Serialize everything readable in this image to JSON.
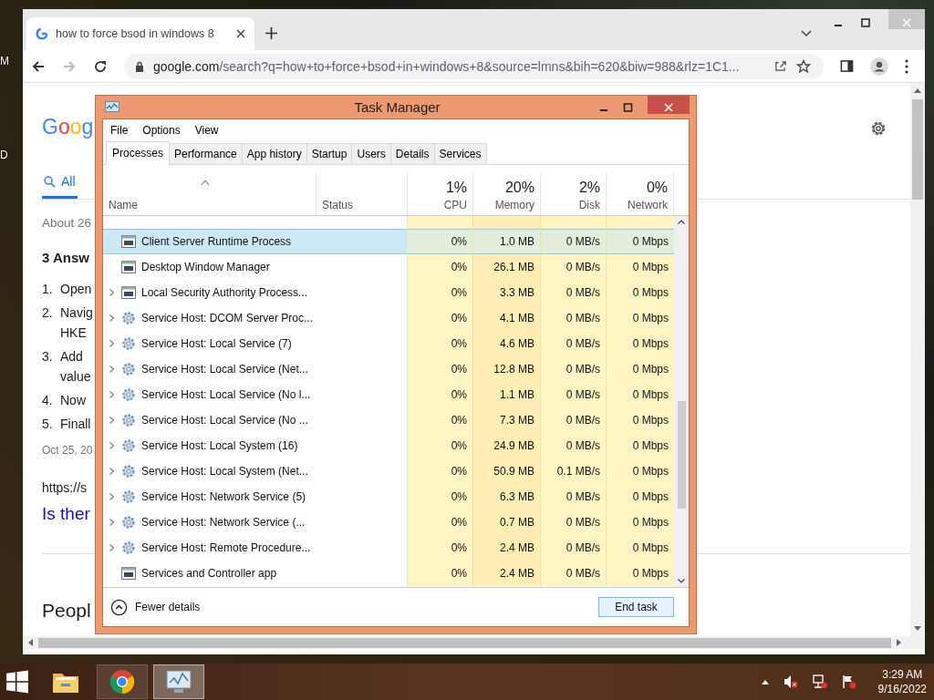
{
  "desktop_labels": [
    "M",
    "D"
  ],
  "browser": {
    "tab": {
      "title": "how to force bsod in windows 8"
    },
    "address": {
      "host": "google.com",
      "path": "/search?q=how+to+force+bsod+in+windows+8&source=lmns&bih=620&biw=988&rlz=1C1..."
    }
  },
  "google": {
    "logo": "Goog",
    "nav_tab": {
      "label": "All",
      "selected": true
    },
    "result_count": "About 26",
    "answer_heading": "3 Answ",
    "steps": [
      {
        "number": "1.",
        "lines": [
          "Open"
        ]
      },
      {
        "number": "2.",
        "lines": [
          "Navig",
          "HKE"
        ]
      },
      {
        "number": "3.",
        "lines": [
          "Add",
          "value"
        ]
      },
      {
        "number": "4.",
        "lines": [
          "Now"
        ]
      },
      {
        "number": "5.",
        "lines": [
          "Finall"
        ]
      }
    ],
    "date": "Oct 25, 20",
    "url": "https://s",
    "link": "Is ther",
    "section_heading": "Peopl"
  },
  "task_manager": {
    "title": "Task Manager",
    "menu": [
      "File",
      "Options",
      "View"
    ],
    "tabs": [
      {
        "label": "Processes",
        "selected": true
      },
      {
        "label": "Performance",
        "selected": false
      },
      {
        "label": "App history",
        "selected": false
      },
      {
        "label": "Startup",
        "selected": false
      },
      {
        "label": "Users",
        "selected": false
      },
      {
        "label": "Details",
        "selected": false
      },
      {
        "label": "Services",
        "selected": false
      }
    ],
    "columns": [
      {
        "label": "Name"
      },
      {
        "label": "Status"
      },
      {
        "summary": "1%",
        "label": "CPU"
      },
      {
        "summary": "20%",
        "label": "Memory"
      },
      {
        "summary": "2%",
        "label": "Disk"
      },
      {
        "summary": "0%",
        "label": "Network"
      }
    ],
    "rows": [
      {
        "name": "Client Server Runtime Process",
        "kind": "window",
        "expandable": false,
        "selected": true,
        "cpu": "0%",
        "memory": "1.0 MB",
        "disk": "0 MB/s",
        "network": "0 Mbps"
      },
      {
        "name": "Desktop Window Manager",
        "kind": "window",
        "expandable": false,
        "selected": false,
        "cpu": "0%",
        "memory": "26.1 MB",
        "disk": "0 MB/s",
        "network": "0 Mbps"
      },
      {
        "name": "Local Security Authority Process...",
        "kind": "window",
        "expandable": true,
        "selected": false,
        "cpu": "0%",
        "memory": "3.3 MB",
        "disk": "0 MB/s",
        "network": "0 Mbps"
      },
      {
        "name": "Service Host: DCOM Server Proc...",
        "kind": "gear",
        "expandable": true,
        "selected": false,
        "cpu": "0%",
        "memory": "4.1 MB",
        "disk": "0 MB/s",
        "network": "0 Mbps"
      },
      {
        "name": "Service Host: Local Service (7)",
        "kind": "gear",
        "expandable": true,
        "selected": false,
        "cpu": "0%",
        "memory": "4.6 MB",
        "disk": "0 MB/s",
        "network": "0 Mbps"
      },
      {
        "name": "Service Host: Local Service (Net...",
        "kind": "gear",
        "expandable": true,
        "selected": false,
        "cpu": "0%",
        "memory": "12.8 MB",
        "disk": "0 MB/s",
        "network": "0 Mbps"
      },
      {
        "name": "Service Host: Local Service (No l...",
        "kind": "gear",
        "expandable": true,
        "selected": false,
        "cpu": "0%",
        "memory": "1.1 MB",
        "disk": "0 MB/s",
        "network": "0 Mbps"
      },
      {
        "name": "Service Host: Local Service (No ...",
        "kind": "gear",
        "expandable": true,
        "selected": false,
        "cpu": "0%",
        "memory": "7.3 MB",
        "disk": "0 MB/s",
        "network": "0 Mbps"
      },
      {
        "name": "Service Host: Local System (16)",
        "kind": "gear",
        "expandable": true,
        "selected": false,
        "cpu": "0%",
        "memory": "24.9 MB",
        "disk": "0 MB/s",
        "network": "0 Mbps"
      },
      {
        "name": "Service Host: Local System (Net...",
        "kind": "gear",
        "expandable": true,
        "selected": false,
        "cpu": "0%",
        "memory": "50.9 MB",
        "disk": "0.1 MB/s",
        "network": "0 Mbps"
      },
      {
        "name": "Service Host: Network Service (5)",
        "kind": "gear",
        "expandable": true,
        "selected": false,
        "cpu": "0%",
        "memory": "6.3 MB",
        "disk": "0 MB/s",
        "network": "0 Mbps"
      },
      {
        "name": "Service Host: Network Service (...",
        "kind": "gear",
        "expandable": true,
        "selected": false,
        "cpu": "0%",
        "memory": "0.7 MB",
        "disk": "0 MB/s",
        "network": "0 Mbps"
      },
      {
        "name": "Service Host: Remote Procedure...",
        "kind": "gear",
        "expandable": true,
        "selected": false,
        "cpu": "0%",
        "memory": "2.4 MB",
        "disk": "0 MB/s",
        "network": "0 Mbps"
      },
      {
        "name": "Services and Controller app",
        "kind": "window",
        "expandable": false,
        "selected": false,
        "cpu": "0%",
        "memory": "2.4 MB",
        "disk": "0 MB/s",
        "network": "0 Mbps"
      }
    ],
    "fewer_details": "Fewer details",
    "end_task": "End task"
  },
  "taskbar": {
    "apps": [
      {
        "kind": "folder",
        "selected": false
      },
      {
        "kind": "browser",
        "selected": false
      },
      {
        "kind": "monitor",
        "selected": true
      }
    ],
    "time": "3:29 AM",
    "date": "9/16/2022"
  }
}
